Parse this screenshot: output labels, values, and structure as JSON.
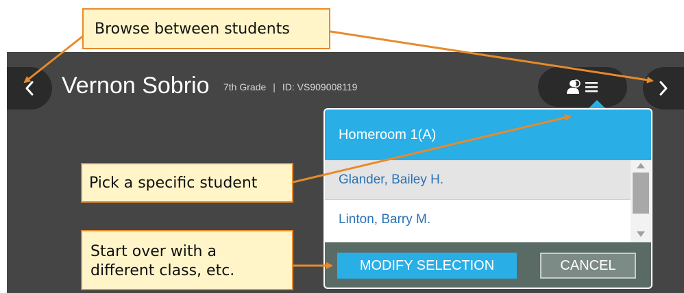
{
  "student": {
    "name": "Vernon Sobrio",
    "grade": "7th Grade",
    "separator": "|",
    "id": "ID: VS909008119"
  },
  "dropdown": {
    "class_name": "Homeroom 1(A)",
    "students": [
      {
        "name": "Glander, Bailey H.",
        "selected": true
      },
      {
        "name": "Linton, Barry M.",
        "selected": false
      }
    ],
    "modify_label": "MODIFY SELECTION",
    "cancel_label": "CANCEL"
  },
  "callouts": {
    "browse": "Browse between students",
    "pick": "Pick a specific student",
    "start_over": "Start over with a\ndifferent class, etc."
  },
  "icons": {
    "prev": "chevron-left-icon",
    "next": "chevron-right-icon",
    "list": "student-list-icon"
  },
  "colors": {
    "accent": "#29aee6",
    "callout_bg": "#fff5c9",
    "callout_border": "#e88a2a",
    "app_bg": "#454545",
    "link": "#2a72b5"
  }
}
